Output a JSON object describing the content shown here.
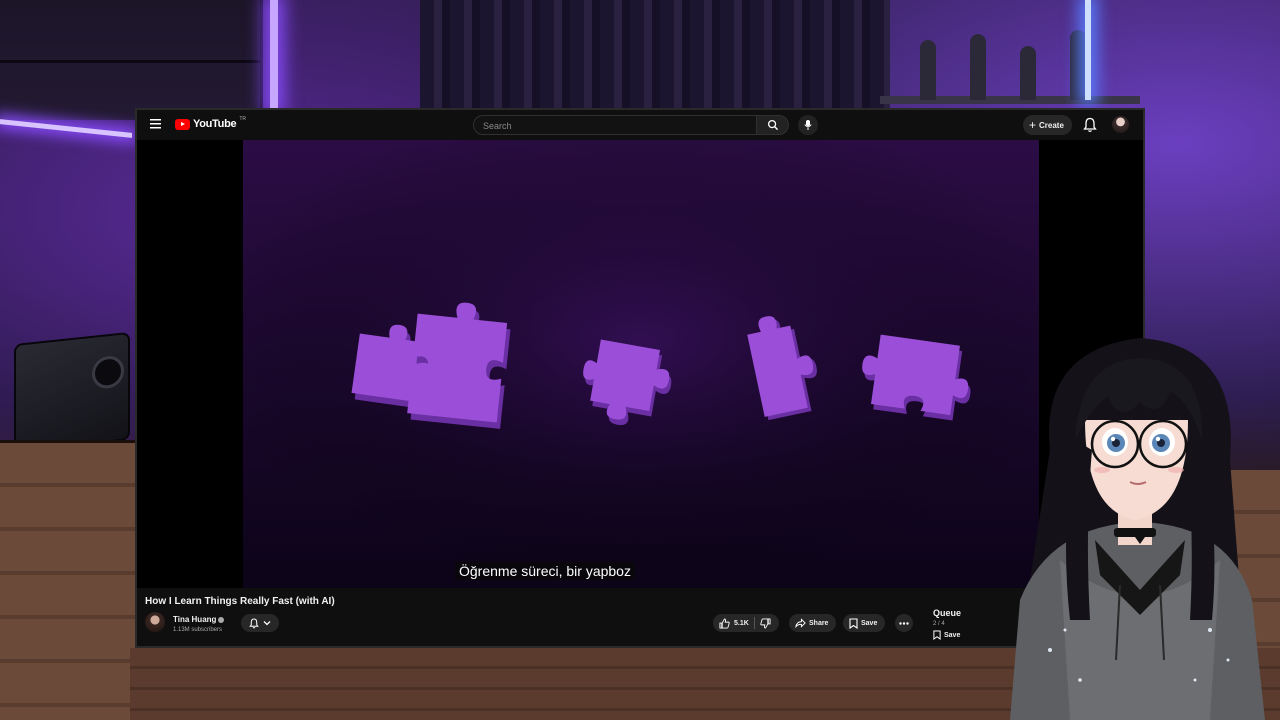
{
  "topbar": {
    "logo_text": "YouTube",
    "logo_tm": "TR",
    "search_placeholder": "Search",
    "create_label": "Create",
    "icons": [
      "menu-icon",
      "search-icon",
      "microphone-icon",
      "plus-icon",
      "bell-icon"
    ]
  },
  "video": {
    "caption": "Öğrenme süreci, bir yapboz",
    "accent_color": "#9b4fd8"
  },
  "details": {
    "title": "How I Learn Things Really Fast (with AI)",
    "channel_name": "Tina Huang",
    "subscribers": "1.13M subscribers",
    "likes": "5.1K",
    "share_label": "Share",
    "save_label": "Save"
  },
  "queue": {
    "title": "Queue",
    "count": "2 / 4",
    "save_label": "Save"
  }
}
